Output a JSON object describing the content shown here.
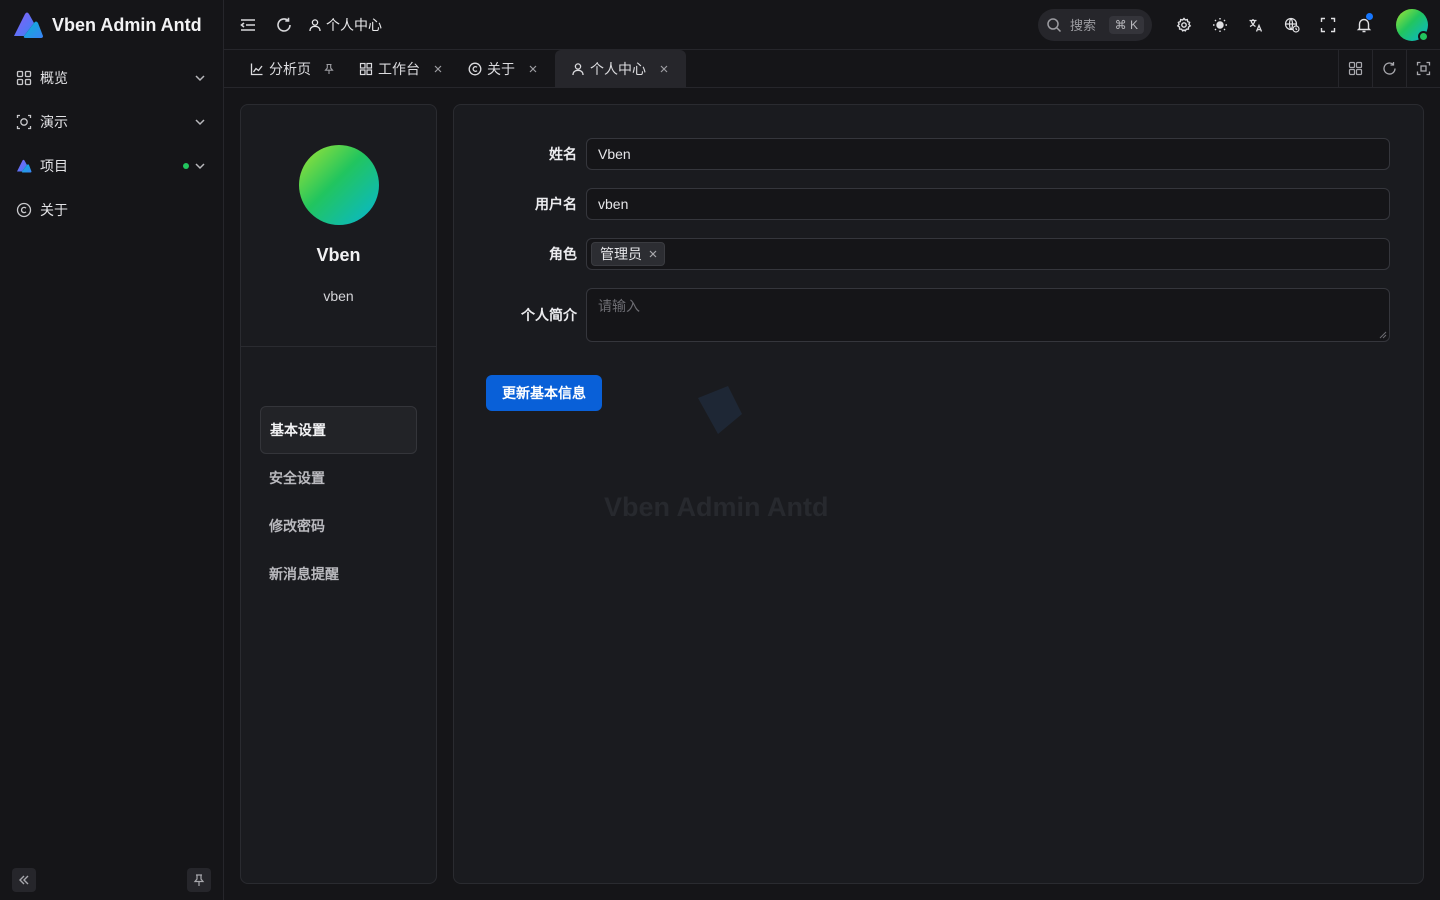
{
  "brand": {
    "title": "Vben Admin Antd"
  },
  "sidebar": {
    "items": [
      {
        "label": "概览",
        "icon": "dashboard-grid-icon"
      },
      {
        "label": "演示",
        "icon": "demo-icon"
      },
      {
        "label": "项目",
        "icon": "project-logo-icon",
        "badge_color": "#22c55e"
      },
      {
        "label": "关于",
        "icon": "copyright-icon"
      }
    ]
  },
  "header": {
    "breadcrumb": "个人中心",
    "search_label": "搜索",
    "search_shortcut": "⌘ K"
  },
  "tabs": [
    {
      "label": "分析页",
      "icon": "chart-icon",
      "pinned": true
    },
    {
      "label": "工作台",
      "icon": "workspace-icon"
    },
    {
      "label": "关于",
      "icon": "copyright-icon"
    },
    {
      "label": "个人中心",
      "icon": "user-icon",
      "active": true
    }
  ],
  "profile": {
    "name": "Vben",
    "username": "vben",
    "menu": [
      "基本设置",
      "安全设置",
      "修改密码",
      "新消息提醒"
    ],
    "active_menu": "基本设置"
  },
  "form": {
    "name_label": "姓名",
    "name_value": "Vben",
    "username_label": "用户名",
    "username_value": "vben",
    "role_label": "角色",
    "role_tags": [
      "管理员"
    ],
    "bio_label": "个人简介",
    "bio_placeholder": "请输入",
    "submit_label": "更新基本信息"
  },
  "watermark": {
    "text": "Vben Admin Antd"
  },
  "colors": {
    "accent": "#0960d8",
    "notification": "#1677ff",
    "online": "#22c55e",
    "background": "#151518",
    "card": "#1a1b1f"
  }
}
